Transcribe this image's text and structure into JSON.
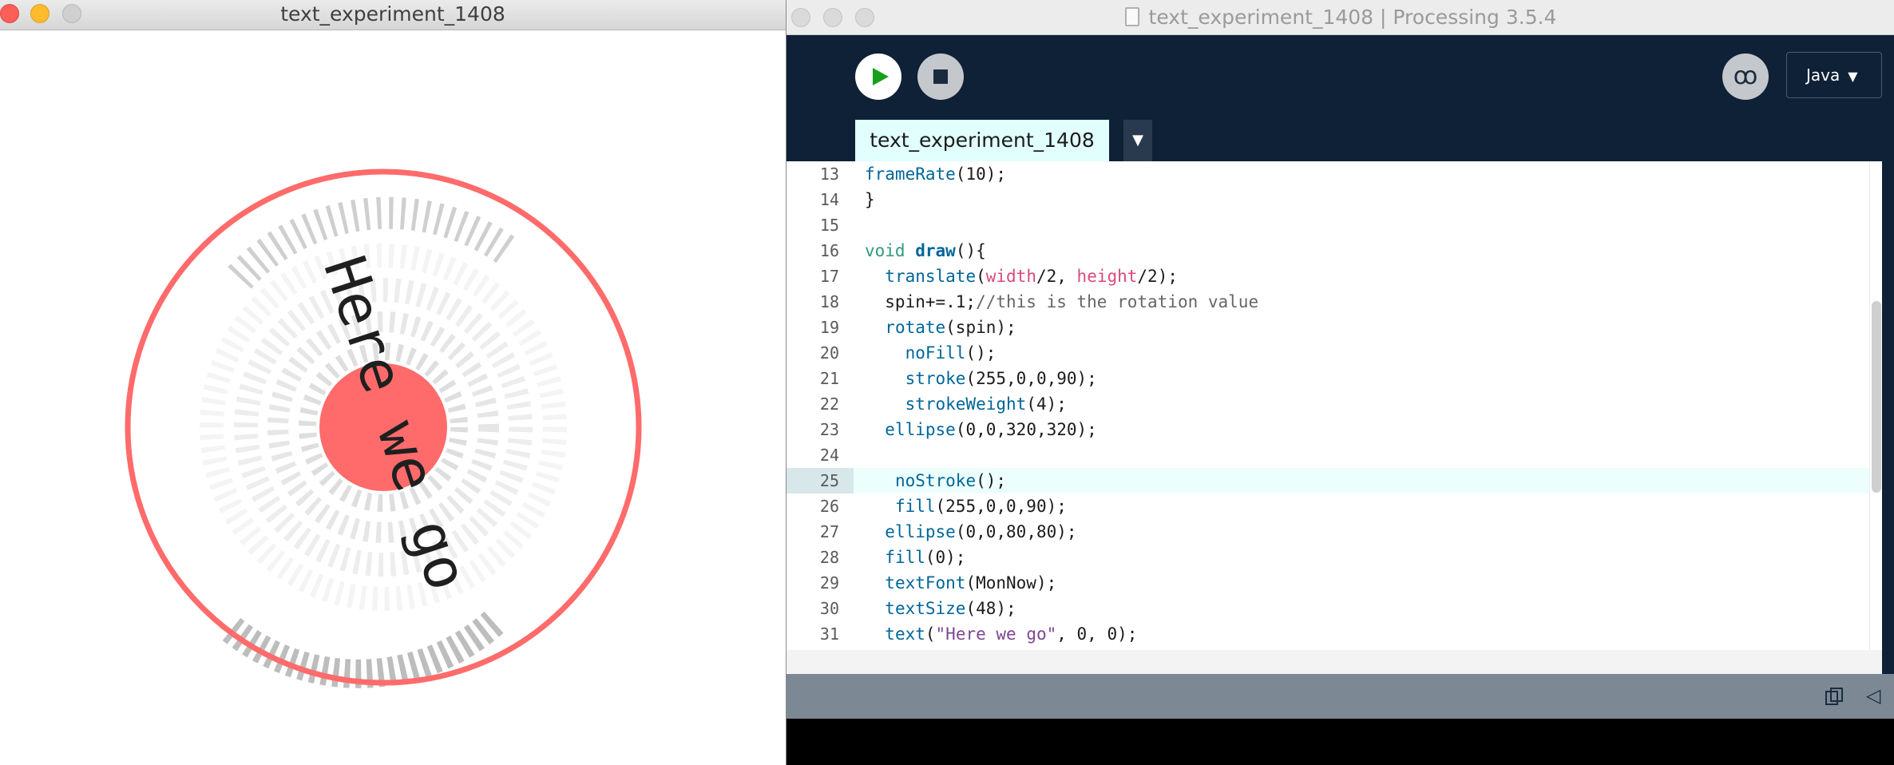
{
  "sketch_window": {
    "title": "text_experiment_1408",
    "traffic_lights": [
      "close",
      "minimize",
      "zoom"
    ],
    "canvas": {
      "outer_ring_color": "#ff6b6b",
      "center_disc_color": "#ff6b6b",
      "text": "Here we go"
    }
  },
  "ide_window": {
    "title": "text_experiment_1408 | Processing 3.5.4",
    "toolbar": {
      "run_icon": "play-icon",
      "stop_icon": "stop-icon",
      "debug_icon": "butterfly-icon",
      "mode_label": "Java",
      "mode_arrow": "▼"
    },
    "tab": {
      "label": "text_experiment_1408",
      "menu_arrow": "▼"
    },
    "editor": {
      "current_line": 25,
      "lines": [
        {
          "n": "13",
          "tokens": [
            {
              "t": "fn",
              "s": "frameRate"
            },
            {
              "t": "",
              "s": "(10);"
            }
          ]
        },
        {
          "n": "14",
          "tokens": [
            {
              "t": "",
              "s": "}"
            }
          ]
        },
        {
          "n": "15",
          "tokens": []
        },
        {
          "n": "16",
          "tokens": [
            {
              "t": "kw",
              "s": "void"
            },
            {
              "t": "",
              "s": " "
            },
            {
              "t": "kwb",
              "s": "draw"
            },
            {
              "t": "",
              "s": "(){"
            }
          ]
        },
        {
          "n": "17",
          "tokens": [
            {
              "t": "",
              "s": "  "
            },
            {
              "t": "fn",
              "s": "translate"
            },
            {
              "t": "",
              "s": "("
            },
            {
              "t": "var",
              "s": "width"
            },
            {
              "t": "",
              "s": "/2, "
            },
            {
              "t": "var",
              "s": "height"
            },
            {
              "t": "",
              "s": "/2);"
            }
          ]
        },
        {
          "n": "18",
          "tokens": [
            {
              "t": "",
              "s": "  spin+=.1;"
            },
            {
              "t": "cm",
              "s": "//this is the rotation value"
            }
          ]
        },
        {
          "n": "19",
          "tokens": [
            {
              "t": "",
              "s": "  "
            },
            {
              "t": "fn",
              "s": "rotate"
            },
            {
              "t": "",
              "s": "(spin);"
            }
          ]
        },
        {
          "n": "20",
          "tokens": [
            {
              "t": "",
              "s": "    "
            },
            {
              "t": "fn",
              "s": "noFill"
            },
            {
              "t": "",
              "s": "();"
            }
          ]
        },
        {
          "n": "21",
          "tokens": [
            {
              "t": "",
              "s": "    "
            },
            {
              "t": "fn",
              "s": "stroke"
            },
            {
              "t": "",
              "s": "(255,0,0,90);"
            }
          ]
        },
        {
          "n": "22",
          "tokens": [
            {
              "t": "",
              "s": "    "
            },
            {
              "t": "fn",
              "s": "strokeWeight"
            },
            {
              "t": "",
              "s": "(4);"
            }
          ]
        },
        {
          "n": "23",
          "tokens": [
            {
              "t": "",
              "s": "  "
            },
            {
              "t": "fn",
              "s": "ellipse"
            },
            {
              "t": "",
              "s": "(0,0,320,320);"
            }
          ]
        },
        {
          "n": "24",
          "tokens": []
        },
        {
          "n": "25",
          "tokens": [
            {
              "t": "",
              "s": "   "
            },
            {
              "t": "fn",
              "s": "noStroke"
            },
            {
              "t": "",
              "s": "();"
            }
          ]
        },
        {
          "n": "26",
          "tokens": [
            {
              "t": "",
              "s": "   "
            },
            {
              "t": "fn",
              "s": "fill"
            },
            {
              "t": "",
              "s": "(255,0,0,90);"
            }
          ]
        },
        {
          "n": "27",
          "tokens": [
            {
              "t": "",
              "s": "  "
            },
            {
              "t": "fn",
              "s": "ellipse"
            },
            {
              "t": "",
              "s": "(0,0,80,80);"
            }
          ]
        },
        {
          "n": "28",
          "tokens": [
            {
              "t": "",
              "s": "  "
            },
            {
              "t": "fn",
              "s": "fill"
            },
            {
              "t": "",
              "s": "(0);"
            }
          ]
        },
        {
          "n": "29",
          "tokens": [
            {
              "t": "",
              "s": "  "
            },
            {
              "t": "fn",
              "s": "textFont"
            },
            {
              "t": "",
              "s": "(MonNow);"
            }
          ]
        },
        {
          "n": "30",
          "tokens": [
            {
              "t": "",
              "s": "  "
            },
            {
              "t": "fn",
              "s": "textSize"
            },
            {
              "t": "",
              "s": "(48);"
            }
          ]
        },
        {
          "n": "31",
          "tokens": [
            {
              "t": "",
              "s": "  "
            },
            {
              "t": "fn",
              "s": "text"
            },
            {
              "t": "",
              "s": "("
            },
            {
              "t": "str",
              "s": "\"Here we go\""
            },
            {
              "t": "",
              "s": ", 0, 0);"
            }
          ]
        }
      ]
    },
    "status_bar": {
      "copy_icon": "copy-icon",
      "collapse_icon": "collapse-console-icon",
      "collapse_glyph": "◁"
    },
    "colors": {
      "editor_bg": "#0f2136",
      "tab_bg": "#e0fffd",
      "function": "#006699",
      "keyword": "#33997e",
      "variable": "#d94a7a",
      "comment": "#666666",
      "string": "#7d4793"
    }
  }
}
